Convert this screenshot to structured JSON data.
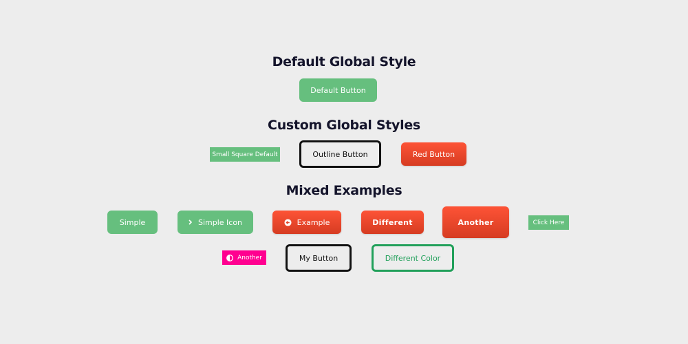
{
  "sections": [
    {
      "title": "Default Global Style"
    },
    {
      "title": "Custom Global Styles"
    },
    {
      "title": "Mixed Examples"
    }
  ],
  "default_section": {
    "default_button": "Default Button"
  },
  "custom_section": {
    "small_square_default": "Small Square Default",
    "outline_button": "Outline Button",
    "red_button": "Red Button"
  },
  "mixed_section": {
    "simple": "Simple",
    "simple_icon": {
      "label": "Simple Icon",
      "icon": "chevron-right-icon"
    },
    "example": {
      "label": "Example",
      "icon": "arrow-circle-left-icon"
    },
    "different": "Different",
    "another_large": "Another",
    "click_here": "Click Here",
    "another_pink": {
      "label": "Another",
      "icon": "contrast-icon"
    },
    "my_button": "My Button",
    "different_color": "Different Color"
  },
  "colors": {
    "background": "#ededed",
    "heading": "#14142b",
    "green": "#66bf7e",
    "red_top": "#fd5336",
    "red_bottom": "#d63c22",
    "pink": "#ff0090",
    "outline_dark": "#111111",
    "outline_green": "#21a05a"
  }
}
